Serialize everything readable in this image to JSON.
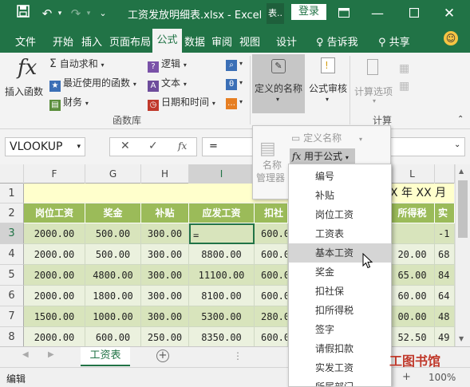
{
  "window": {
    "title": "工资发放明细表.xlsx - Excel",
    "ext_label": "表..",
    "login_label": "登录"
  },
  "tabs": [
    "文件",
    "开始",
    "插入",
    "页面布局",
    "公式",
    "数据",
    "审阅",
    "视图",
    "设计"
  ],
  "tell_me": "告诉我",
  "share": "共享",
  "ribbon": {
    "insert_fn": "插入函数",
    "fx_glyph": "fx",
    "autosum": "自动求和",
    "recent": "最近使用的函数",
    "finance": "财务",
    "logical": "逻辑",
    "text": "文本",
    "datetime": "日期和时间",
    "library_label": "函数库",
    "defined_names": "定义的名称",
    "audit": "公式审核",
    "calc_options": "计算选项",
    "calc_label": "计算"
  },
  "formula_bar": {
    "name_box": "VLOOKUP",
    "formula": "=",
    "fx_label": "fx"
  },
  "popup": {
    "define_name": "定义名称",
    "use_in_formula": "用于公式",
    "name_manager_1": "名称",
    "name_manager_2": "管理器"
  },
  "menu_items": [
    "编号",
    "补贴",
    "岗位工资",
    "工资表",
    "基本工资",
    "奖金",
    "扣社保",
    "扣所得税",
    "签字",
    "请假扣款",
    "实发工资",
    "所属部门"
  ],
  "menu_highlight_index": 4,
  "columns": [
    "F",
    "G",
    "H",
    "I",
    "",
    "L"
  ],
  "rows": [
    "1",
    "2",
    "3",
    "4",
    "5",
    "6",
    "7",
    "8"
  ],
  "row1_text": "X 年 XX 月",
  "headers": [
    "岗位工资",
    "奖金",
    "补贴",
    "应发工资",
    "扣社",
    "所得税",
    "实"
  ],
  "data_rows": [
    [
      "2000.00",
      "500.00",
      "300.00",
      "=",
      "600.0",
      "",
      "-1"
    ],
    [
      "2000.00",
      "500.00",
      "300.00",
      "8800.00",
      "600.0",
      "20.00",
      "68"
    ],
    [
      "2000.00",
      "4800.00",
      "300.00",
      "11100.00",
      "600.0",
      "65.00",
      "84"
    ],
    [
      "2000.00",
      "1800.00",
      "300.00",
      "8100.00",
      "600.0",
      "60.00",
      "64"
    ],
    [
      "1500.00",
      "1000.00",
      "300.00",
      "5300.00",
      "280.0",
      "00.00",
      "48"
    ],
    [
      "2000.00",
      "600.00",
      "250.00",
      "8350.00",
      "600.0",
      "52.50",
      "49"
    ]
  ],
  "sheet_tab": "工资表",
  "status": "编辑",
  "zoom": "100%",
  "watermark": "工图书馆",
  "colors": {
    "brand": "#217346",
    "header_green": "#9bbb59",
    "row_odd": "#d8e4bc",
    "row_even": "#ebf1de"
  }
}
